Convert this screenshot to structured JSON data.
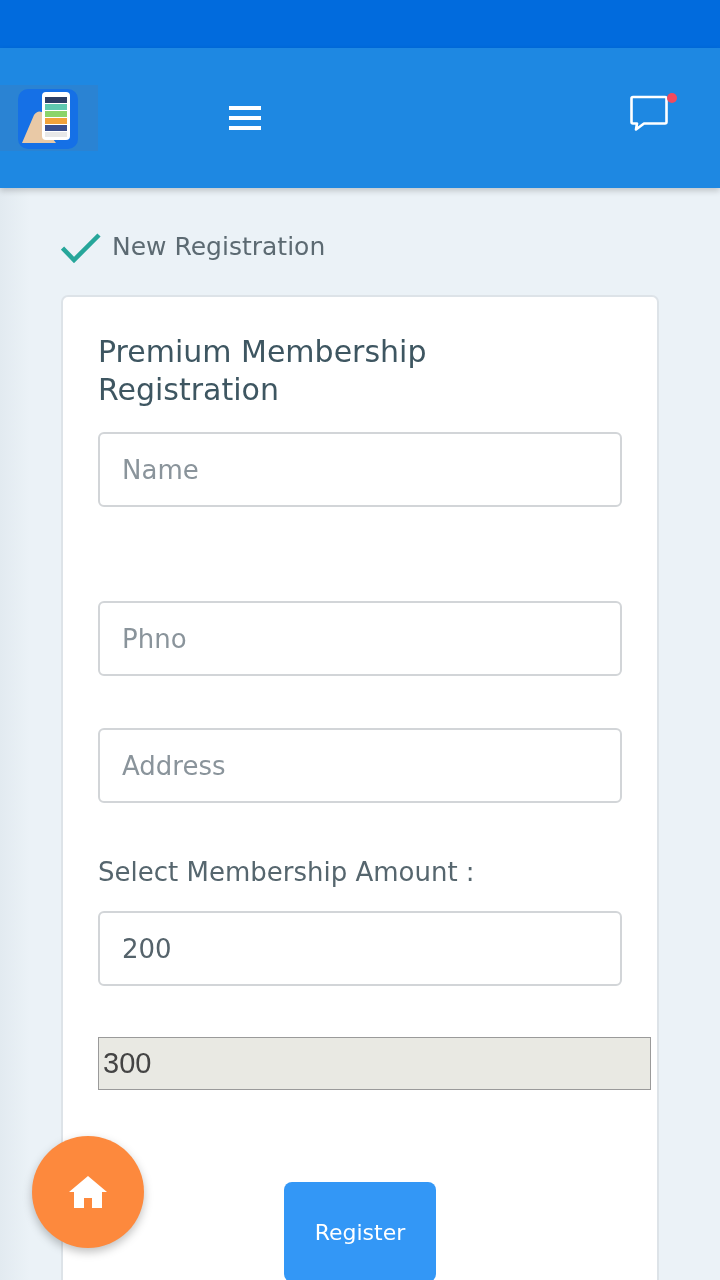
{
  "header": {
    "chat": {
      "unread": true
    }
  },
  "page_heading": "New Registration",
  "form": {
    "title": "Premium Membership Registration",
    "fields": [
      {
        "placeholder": "Name"
      },
      {
        "placeholder": "Phno"
      },
      {
        "placeholder": "Address"
      }
    ],
    "amount": {
      "label": "Select Membership Amount :",
      "options": [
        {
          "value": "200",
          "disabled": false
        },
        {
          "value": "300",
          "disabled": true
        }
      ]
    },
    "submit": "Register"
  }
}
